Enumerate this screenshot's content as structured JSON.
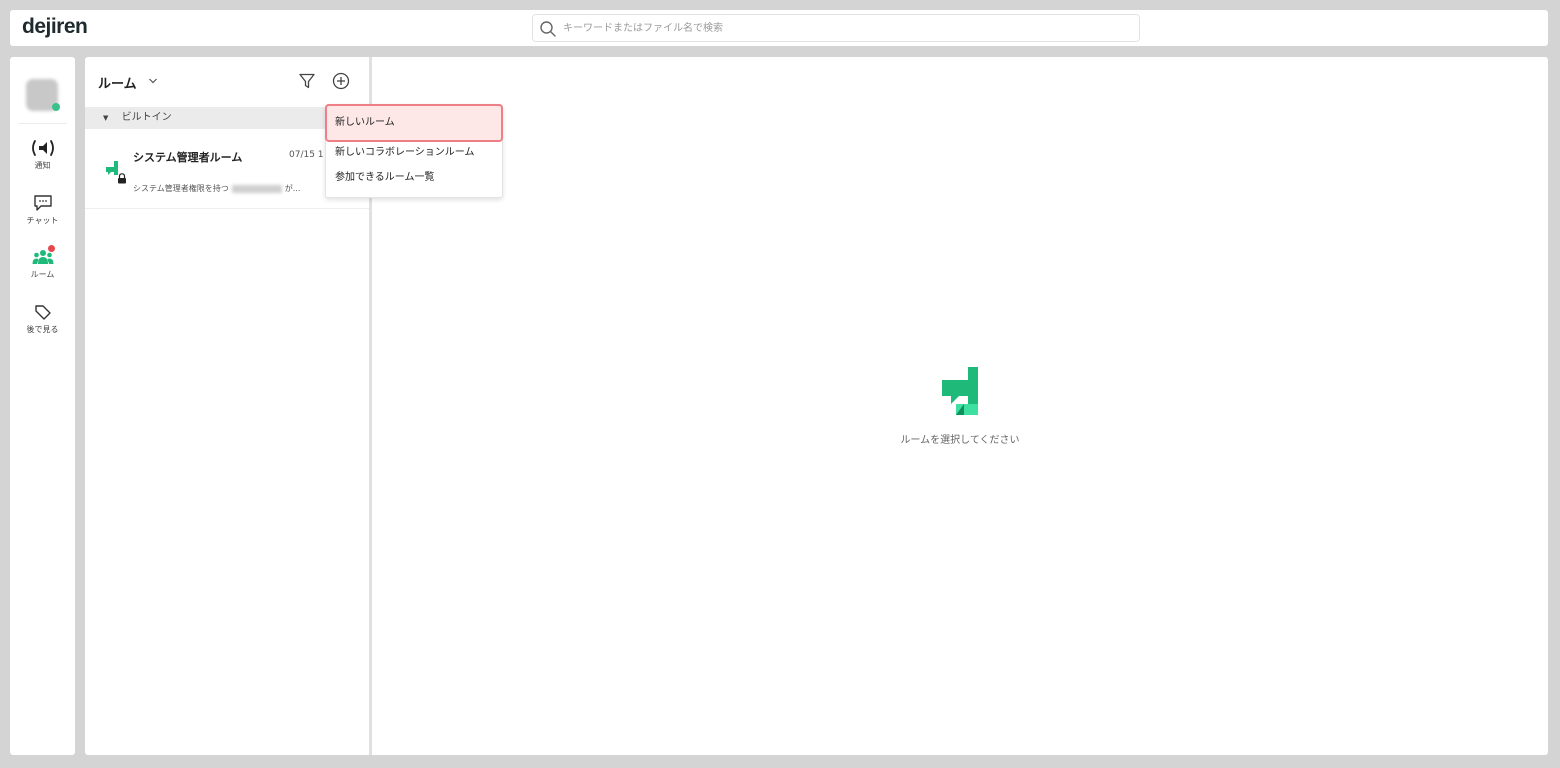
{
  "app": {
    "logo": "dejiren"
  },
  "search": {
    "placeholder": "キーワードまたはファイル名で検索",
    "icon": "search-icon"
  },
  "sidebar": {
    "items": [
      {
        "label": "通知",
        "icon": "broadcast-icon"
      },
      {
        "label": "チャット",
        "icon": "chat-icon"
      },
      {
        "label": "ルーム",
        "icon": "room-icon",
        "active": true,
        "badge": true
      },
      {
        "label": "後で見る",
        "icon": "tag-icon"
      }
    ]
  },
  "room_panel": {
    "title": "ルーム",
    "group": "ビルトイン",
    "rooms": [
      {
        "name": "システム管理者ルーム",
        "date": "07/15 1",
        "preview_start": "システム管理者権限を持つ",
        "preview_end": "が..."
      }
    ]
  },
  "menu": {
    "items": [
      "新しいルーム",
      "新しいコラボレーションルーム",
      "参加できるルーム一覧"
    ]
  },
  "main": {
    "hint": "ルームを選択してください"
  },
  "colors": {
    "brand_green": "#1fb97a",
    "badge_red": "#e5484d",
    "highlight_border": "#ef7f86"
  }
}
